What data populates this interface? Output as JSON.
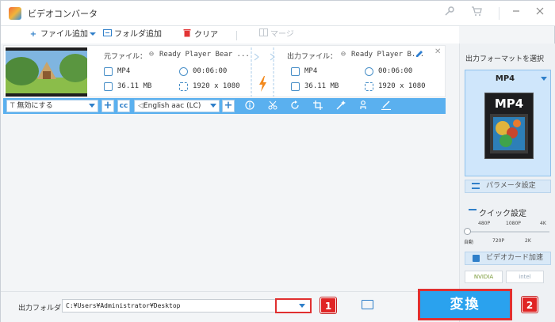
{
  "titlebar": {
    "title": "ビデオコンバータ",
    "buttons": [
      "key-icon",
      "cart-icon",
      "minimize-icon",
      "close-icon"
    ]
  },
  "toolbar": {
    "add_file": "ファイル追加",
    "add_folder": "フォルダ追加",
    "clear": "クリア",
    "merge": "マージ"
  },
  "file": {
    "source_label": "元ファイル：",
    "source_name": "Ready Player Bear ...",
    "source_format": "MP4",
    "source_duration": "00:06:00",
    "source_size": "36.11 MB",
    "source_resolution": "1920 x 1080",
    "output_label": "出力ファイル：",
    "output_name": "Ready Player B...",
    "output_format": "MP4",
    "output_duration": "00:06:00",
    "output_size": "36.11 MB",
    "output_resolution": "1920 x 1080"
  },
  "editbar": {
    "subtitle": "無効にする",
    "audio": "English aac (LC)",
    "tools": [
      "info-icon",
      "cut-icon",
      "rotate-icon",
      "crop-icon",
      "effect-icon",
      "watermark-icon",
      "subtitle-edit-icon"
    ]
  },
  "right": {
    "format_title": "出力フォーマットを選択",
    "format_name": "MP4",
    "format_icon_text": "MP4",
    "params_label": "パラメータ設定",
    "quick_label": "クイック設定",
    "res_top": [
      "480P",
      "1080P",
      "4K"
    ],
    "res_bottom": [
      "自動",
      "720P",
      "2K"
    ],
    "quality_level": 0,
    "gpu_label": "ビデオカード加速",
    "vendor_nvidia": "NVIDIA",
    "vendor_intel": "intel"
  },
  "bottom": {
    "output_label": "出力フォルダ：",
    "output_path": "C:¥Users¥Administrator¥Desktop",
    "badge1": "1",
    "badge2": "2",
    "convert_label": "変換"
  },
  "colors": {
    "accent": "#2aa2ee",
    "editbar": "#5ab0ef",
    "highlight": "#e03030"
  }
}
